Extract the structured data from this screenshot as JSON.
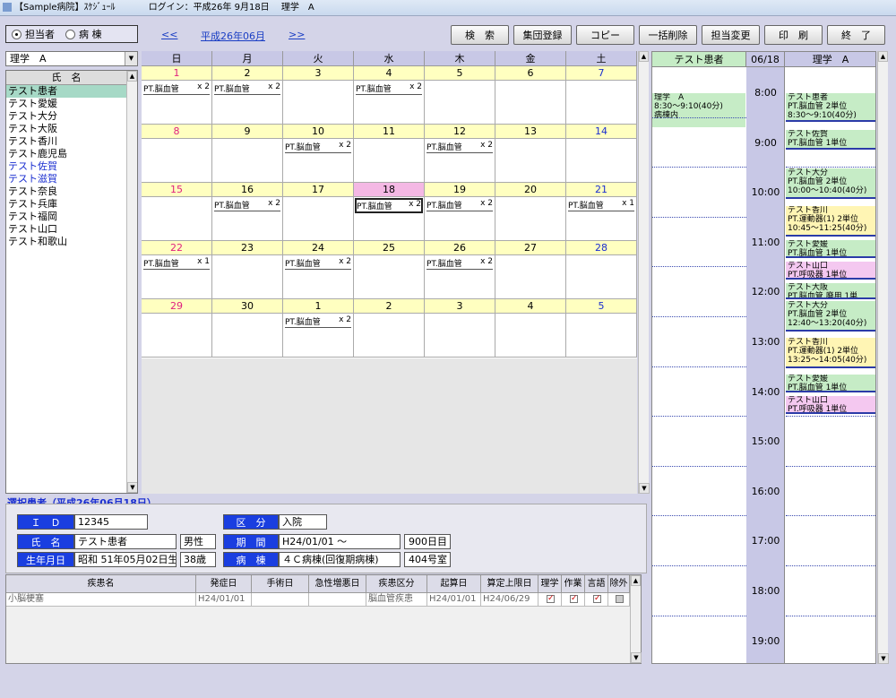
{
  "title_bar": {
    "app": "【Sample病院】ｽｹｼﾞｭｰﾙ",
    "login": "ログイン：平成26年 9月18日",
    "user": "理学　A"
  },
  "view_toggle": {
    "options": [
      "担当者",
      "病 棟"
    ],
    "selected": 0
  },
  "nav": {
    "prev": "<<",
    "month": "平成26年06月",
    "next": ">>"
  },
  "toolbar": [
    "検　索",
    "集団登録",
    "コピー",
    "一括削除",
    "担当変更",
    "印　刷",
    "終　了"
  ],
  "staff_select": "理学　A",
  "patient_list": {
    "header": "氏　名",
    "items": [
      {
        "name": "テスト患者",
        "selected": true,
        "blue": false
      },
      {
        "name": "テスト愛媛",
        "blue": false
      },
      {
        "name": "テスト大分",
        "blue": false
      },
      {
        "name": "テスト大阪",
        "blue": false
      },
      {
        "name": "テスト香川",
        "blue": false
      },
      {
        "name": "テスト鹿児島",
        "blue": false
      },
      {
        "name": "テスト佐賀",
        "blue": true
      },
      {
        "name": "テスト滋賀",
        "blue": true
      },
      {
        "name": "テスト奈良",
        "blue": false
      },
      {
        "name": "テスト兵庫",
        "blue": false
      },
      {
        "name": "テスト福岡",
        "blue": false
      },
      {
        "name": "テスト山口",
        "blue": false
      },
      {
        "name": "テスト和歌山",
        "blue": false
      }
    ]
  },
  "calendar": {
    "weekdays": [
      "日",
      "月",
      "火",
      "水",
      "木",
      "金",
      "土"
    ],
    "weeks": [
      [
        {
          "d": "1",
          "ev": "PT.脳血管",
          "n": "x 2"
        },
        {
          "d": "2",
          "ev": "PT.脳血管",
          "n": "x 2"
        },
        {
          "d": "3"
        },
        {
          "d": "4",
          "ev": "PT.脳血管",
          "n": "x 2"
        },
        {
          "d": "5"
        },
        {
          "d": "6"
        },
        {
          "d": "7"
        }
      ],
      [
        {
          "d": "8"
        },
        {
          "d": "9"
        },
        {
          "d": "10",
          "ev": "PT.脳血管",
          "n": "x 2"
        },
        {
          "d": "11"
        },
        {
          "d": "12",
          "ev": "PT.脳血管",
          "n": "x 2"
        },
        {
          "d": "13"
        },
        {
          "d": "14"
        }
      ],
      [
        {
          "d": "15"
        },
        {
          "d": "16",
          "ev": "PT.脳血管",
          "n": "x 2"
        },
        {
          "d": "17"
        },
        {
          "d": "18",
          "ev": "PT.脳血管",
          "n": "x 2",
          "today": true
        },
        {
          "d": "19",
          "ev": "PT.脳血管",
          "n": "x 2"
        },
        {
          "d": "20"
        },
        {
          "d": "21",
          "ev": "PT.脳血管",
          "n": "x 1"
        }
      ],
      [
        {
          "d": "22",
          "ev": "PT.脳血管",
          "n": "x 1"
        },
        {
          "d": "23"
        },
        {
          "d": "24",
          "ev": "PT.脳血管",
          "n": "x 2"
        },
        {
          "d": "25"
        },
        {
          "d": "26",
          "ev": "PT.脳血管",
          "n": "x 2"
        },
        {
          "d": "27"
        },
        {
          "d": "28"
        }
      ],
      [
        {
          "d": "29"
        },
        {
          "d": "30"
        },
        {
          "d": "1",
          "ev": "PT.脳血管",
          "n": "x 2"
        },
        {
          "d": "2"
        },
        {
          "d": "3"
        },
        {
          "d": "4"
        },
        {
          "d": "5"
        }
      ]
    ]
  },
  "day_schedule": {
    "patient_header": "テスト患者",
    "date_header": "06/18",
    "staff_header": "理学　A",
    "patient_block": [
      "理学　A",
      "8:30～9:10(40分)",
      "病棟内"
    ],
    "times": [
      "8:00",
      "9:00",
      "10:00",
      "11:00",
      "12:00",
      "13:00",
      "14:00",
      "15:00",
      "16:00",
      "17:00",
      "18:00",
      "19:00"
    ],
    "blocks": [
      {
        "color": "green",
        "lines": [
          "テスト患者",
          " PT.脳血管 2単位",
          " 8:30～9:10(40分)"
        ]
      },
      {
        "color": "green",
        "lines": [
          "テスト佐賀",
          " PT.脳血管 1単位"
        ]
      },
      {
        "color": "green",
        "lines": [
          "テスト大分",
          " PT.脳血管 2単位",
          " 10:00～10:40(40分)"
        ]
      },
      {
        "color": "yellow",
        "lines": [
          "テスト香川",
          " PT.運動器(1) 2単位",
          " 10:45～11:25(40分)"
        ]
      },
      {
        "color": "green",
        "lines": [
          "テスト愛媛",
          " PT.脳血管 1単位"
        ]
      },
      {
        "color": "pink",
        "lines": [
          "テスト山口",
          " PT.呼吸器 1単位"
        ]
      },
      {
        "color": "green",
        "lines": [
          "テスト大阪",
          " PT.脳血管,廃用 1単"
        ]
      },
      {
        "color": "green",
        "lines": [
          "テスト大分",
          " PT.脳血管 2単位",
          " 12:40～13:20(40分)"
        ]
      },
      {
        "color": "yellow",
        "lines": [
          "テスト香川",
          " PT.運動器(1) 2単位",
          " 13:25～14:05(40分)"
        ]
      },
      {
        "color": "green",
        "lines": [
          "テスト愛媛",
          " PT.脳血管 1単位"
        ]
      },
      {
        "color": "pink",
        "lines": [
          "テスト山口",
          " PT.呼吸器 1単位"
        ]
      }
    ]
  },
  "selected_patient": {
    "title": "選択患者（平成26年06月18日）",
    "labels": {
      "id": "Ｉ　Ｄ",
      "name": "氏　名",
      "birth": "生年月日",
      "kubun": "区　分",
      "period": "期　間",
      "ward": "病　棟"
    },
    "id": "12345",
    "name": "テスト患者",
    "sex": "男性",
    "birth": "昭和 51年05月02日生",
    "age": "38歳",
    "kubun": "入院",
    "period": "H24/01/01 ～",
    "days": "900日目",
    "ward": "４Ｃ病棟(回復期病棟)",
    "room": "404号室"
  },
  "disease_table": {
    "headers": [
      "疾患名",
      "発症日",
      "手術日",
      "急性増悪日",
      "疾患区分",
      "起算日",
      "算定上限日",
      "理学",
      "作業",
      "言語",
      "除外"
    ],
    "rows": [
      {
        "name": "小脳梗塞",
        "onset": "H24/01/01",
        "surgery": "",
        "acute": "",
        "category": "脳血管疾患",
        "start": "H24/01/01",
        "limit": "H24/06/29"
      }
    ]
  }
}
